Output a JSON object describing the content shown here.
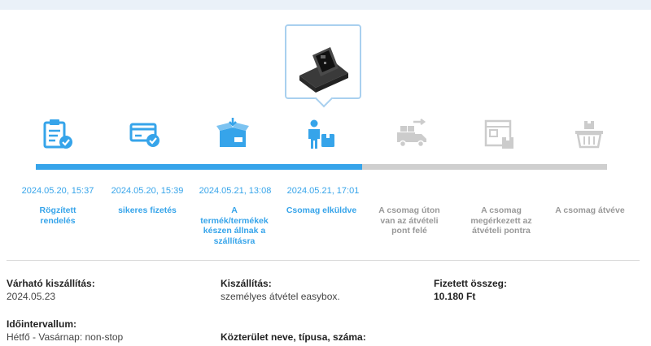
{
  "colors": {
    "accent": "#36a4ea",
    "inactive": "#cccccc",
    "track": "#cfcfcf"
  },
  "progress": {
    "completed_steps": 4,
    "total_steps": 7
  },
  "steps": [
    {
      "icon": "clipboard-check-icon",
      "date": "2024.05.20, 15:37",
      "label": "Rögzített rendelés",
      "status": "done"
    },
    {
      "icon": "credit-card-check-icon",
      "date": "2024.05.20, 15:39",
      "label": "sikeres fizetés",
      "status": "done"
    },
    {
      "icon": "open-box-icon",
      "date": "2024.05.21, 13:08",
      "label": "A termék/termékek készen állnak a szállításra",
      "status": "done"
    },
    {
      "icon": "courier-package-icon",
      "date": "2024.05.21, 17:01",
      "label": "Csomag elküldve",
      "status": "done"
    },
    {
      "icon": "delivery-truck-icon",
      "date": "",
      "label": "A csomag úton van az átvételi pont felé",
      "status": "todo"
    },
    {
      "icon": "pickup-point-icon",
      "date": "",
      "label": "A csomag megérkezett az átvételi pontra",
      "status": "todo"
    },
    {
      "icon": "basket-icon",
      "date": "",
      "label": "A csomag átvéve",
      "status": "todo"
    }
  ],
  "info": {
    "expected_delivery_title": "Várható kiszállítás:",
    "expected_delivery_value": "2024.05.23",
    "shipping_title": "Kiszállítás:",
    "shipping_value": "személyes átvétel easybox.",
    "paid_title": "Fizetett összeg:",
    "paid_value": "10.180 Ft",
    "interval_title": "Időintervallum:",
    "interval_value": "Hétfő - Vasárnap: non-stop",
    "address_title": "Közterület neve, típusa, száma:"
  }
}
